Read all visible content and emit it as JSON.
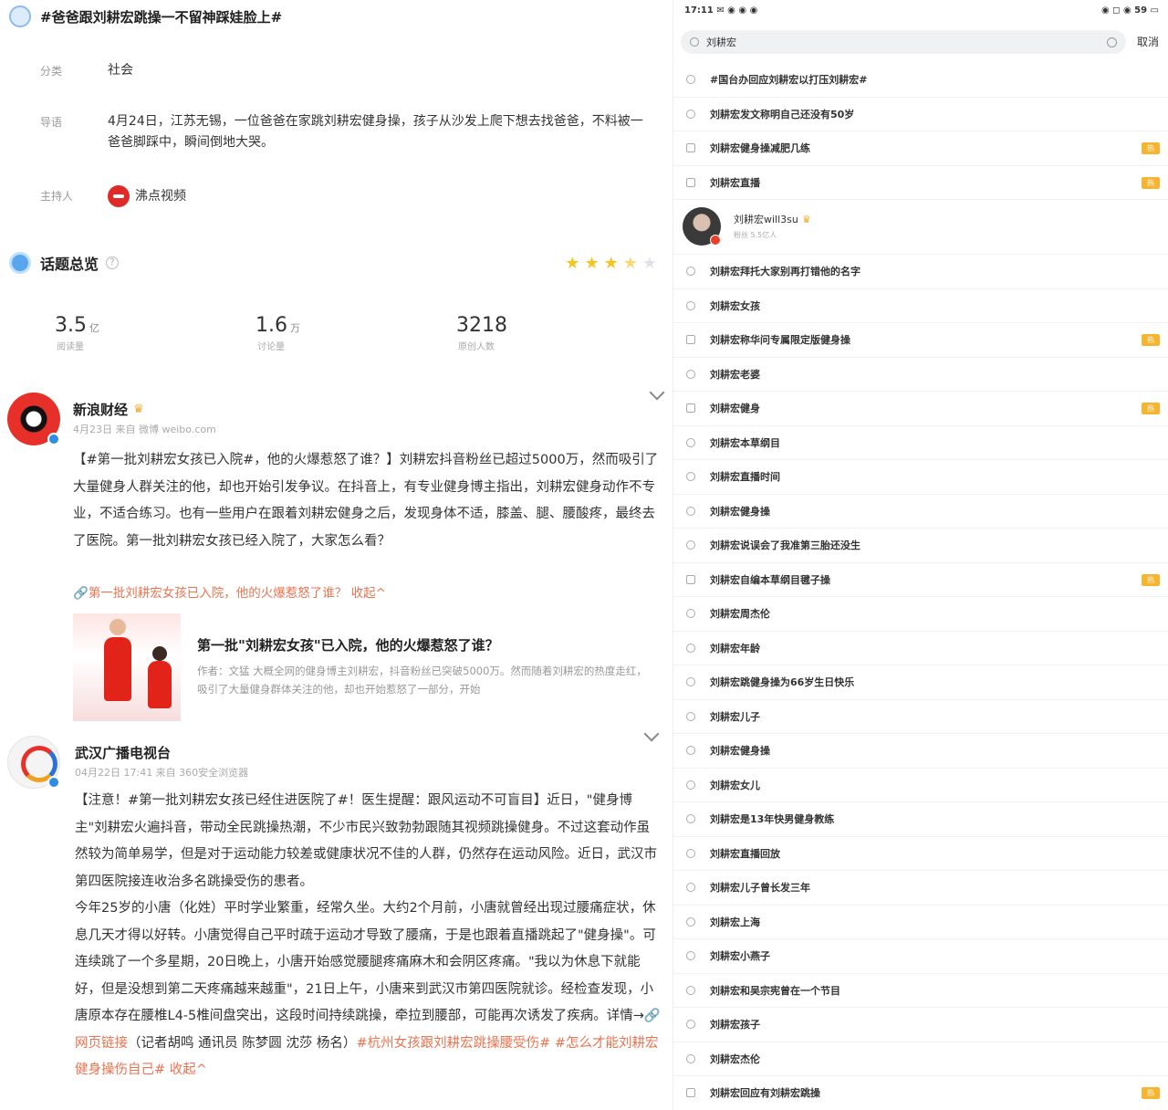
{
  "topic": {
    "title": "#爸爸跟刘耕宏跳操一不留神踩娃脸上#",
    "rows": [
      {
        "label": "分类",
        "value": "社会"
      },
      {
        "label": "导语",
        "value": "4月24日，江苏无锡，一位爸爸在家跳刘耕宏健身操，孩子从沙发上爬下想去找爸爸，不料被一爸爸脚踩中，瞬间倒地大哭。"
      },
      {
        "label": "主持人",
        "value": "沸点视频"
      }
    ]
  },
  "overview": {
    "title": "话题总览",
    "stars": [
      "full",
      "full",
      "full",
      "half",
      "off"
    ],
    "stats": [
      {
        "value": "3.5",
        "unit": "亿",
        "label": "阅读量"
      },
      {
        "value": "1.6",
        "unit": "万",
        "label": "讨论量"
      },
      {
        "value": "3218",
        "unit": "",
        "label": "原创人数"
      }
    ]
  },
  "posts": [
    {
      "author": "新浪财经",
      "meta": "4月23日 来自 微博 weibo.com",
      "body_text": "【#第一批刘耕宏女孩已入院#，他的火爆惹怒了谁？】刘耕宏抖音粉丝已超过5000万，然而吸引了大量健身人群关注的他，却也开始引发争议。在抖音上，有专业健身博主指出，刘耕宏健身动作不专业，不适合练习。也有一些用户在跟着刘耕宏健身之后，发现身体不适，膝盖、腿、腰酸疼，最终去了医院。第一批刘耕宏女孩已经入院了，大家怎么看？",
      "footer_link": "第一批刘耕宏女孩已入院，他的火爆惹怒了谁？",
      "collapse": "收起",
      "article": {
        "title": "第一批\"刘耕宏女孩\"已入院，他的火爆惹怒了谁？",
        "desc": "作者：文猛 大概全网的健身博主刘耕宏，抖音粉丝已突破5000万。然而随着刘耕宏的热度走红，吸引了大量健身群体关注的他，却也开始惹怒了一部分，开始"
      }
    },
    {
      "author": "武汉广播电视台",
      "meta": "04月22日 17:41 来自 360安全浏览器",
      "para1": "【注意！#第一批刘耕宏女孩已经住进医院了#！医生提醒：跟风运动不可盲目】近日，\"健身博主\"刘耕宏火遍抖音，带动全民跳操热潮，不少市民兴致勃勃跟随其视频跳操健身。不过这套动作虽然较为简单易学，但是对于运动能力较差或健康状况不佳的人群，仍然存在运动风险。近日，武汉市第四医院接连收治多名跳操受伤的患者。",
      "para2": "今年25岁的小唐（化姓）平时学业繁重，经常久坐。大约2个月前，小唐就曾经出现过腰痛症状，休息几天才得以好转。小唐觉得自己平时疏于运动才导致了腰痛，于是也跟着直播跳起了\"健身操\"。可连续跳了一个多星期，20日晚上，小唐开始感觉腰腿疼痛麻木和会阴区疼痛。\"我以为休息下就能好，但是没想到第二天疼痛越来越重\"，21日上午，小唐来到武汉市第四医院就诊。经检查发现，小唐原本存在腰椎L4-5椎间盘突出，这段时间持续跳操，牵拉到腰部，可能再次诱发了疾病。详情→",
      "link_text": "网页链接",
      "credit": "（记者胡鸣 通讯员 陈梦圆 沈莎 杨名）",
      "tags": "#杭州女孩跟刘耕宏跳操腰受伤# #怎么才能刘耕宏健身操伤自己#",
      "collapse": "收起"
    }
  ],
  "search": {
    "statusbar_left": "17:11 ✉ ◉ ◉ ◉",
    "statusbar_right": "◉ ◻ ◉ 59 ▭",
    "query": "刘耕宏",
    "cancel": "取消",
    "user": {
      "name": "刘耕宏will3su",
      "sub": "粉丝 5.5亿人"
    },
    "items": [
      {
        "text": "#国台办回应刘耕宏以打压刘耕宏#",
        "icon": "clock",
        "badge": false
      },
      {
        "text": "刘耕宏发文称明自己还没有50岁",
        "icon": "search",
        "badge": false
      },
      {
        "text": "刘耕宏健身操减肥几练",
        "icon": "box",
        "badge": true
      },
      {
        "text": "刘耕宏直播",
        "icon": "box",
        "badge": true
      },
      {
        "text": "USER",
        "icon": "",
        "badge": false
      },
      {
        "text": "刘耕宏拜托大家别再打错他的名字",
        "icon": "search",
        "badge": false
      },
      {
        "text": "刘耕宏女孩",
        "icon": "search",
        "badge": false
      },
      {
        "text": "刘耕宏称华问专属限定版健身操",
        "icon": "box",
        "badge": true
      },
      {
        "text": "刘耕宏老婆",
        "icon": "search",
        "badge": false
      },
      {
        "text": "刘耕宏健身",
        "icon": "box",
        "badge": true
      },
      {
        "text": "刘耕宏本草纲目",
        "icon": "search",
        "badge": false
      },
      {
        "text": "刘耕宏直播时间",
        "icon": "search",
        "badge": false
      },
      {
        "text": "刘耕宏健身操",
        "icon": "search",
        "badge": false
      },
      {
        "text": "刘耕宏说误会了我准第三胎还没生",
        "icon": "search",
        "badge": false
      },
      {
        "text": "刘耕宏自编本草纲目毽子操",
        "icon": "box",
        "badge": true
      },
      {
        "text": "刘耕宏周杰伦",
        "icon": "search",
        "badge": false
      },
      {
        "text": "刘耕宏年龄",
        "icon": "search",
        "badge": false
      },
      {
        "text": "刘耕宏跳健身操为66岁生日快乐",
        "icon": "search",
        "badge": false
      },
      {
        "text": "刘耕宏儿子",
        "icon": "search",
        "badge": false
      },
      {
        "text": "刘耕宏健身操",
        "icon": "search",
        "badge": false
      },
      {
        "text": "刘耕宏女儿",
        "icon": "search",
        "badge": false
      },
      {
        "text": "刘耕宏是13年快男健身教练",
        "icon": "search",
        "badge": false
      },
      {
        "text": "刘耕宏直播回放",
        "icon": "search",
        "badge": false
      },
      {
        "text": "刘耕宏儿子曾长发三年",
        "icon": "search",
        "badge": false
      },
      {
        "text": "刘耕宏上海",
        "icon": "search",
        "badge": false
      },
      {
        "text": "刘耕宏小燕子",
        "icon": "search",
        "badge": false
      },
      {
        "text": "刘耕宏和吴宗宪曾在一个节目",
        "icon": "search",
        "badge": false
      },
      {
        "text": "刘耕宏孩子",
        "icon": "search",
        "badge": false
      },
      {
        "text": "刘耕宏杰伦",
        "icon": "search",
        "badge": false
      },
      {
        "text": "刘耕宏回应有刘耕宏跳操",
        "icon": "box",
        "badge": true
      }
    ],
    "badge_label": "热"
  }
}
